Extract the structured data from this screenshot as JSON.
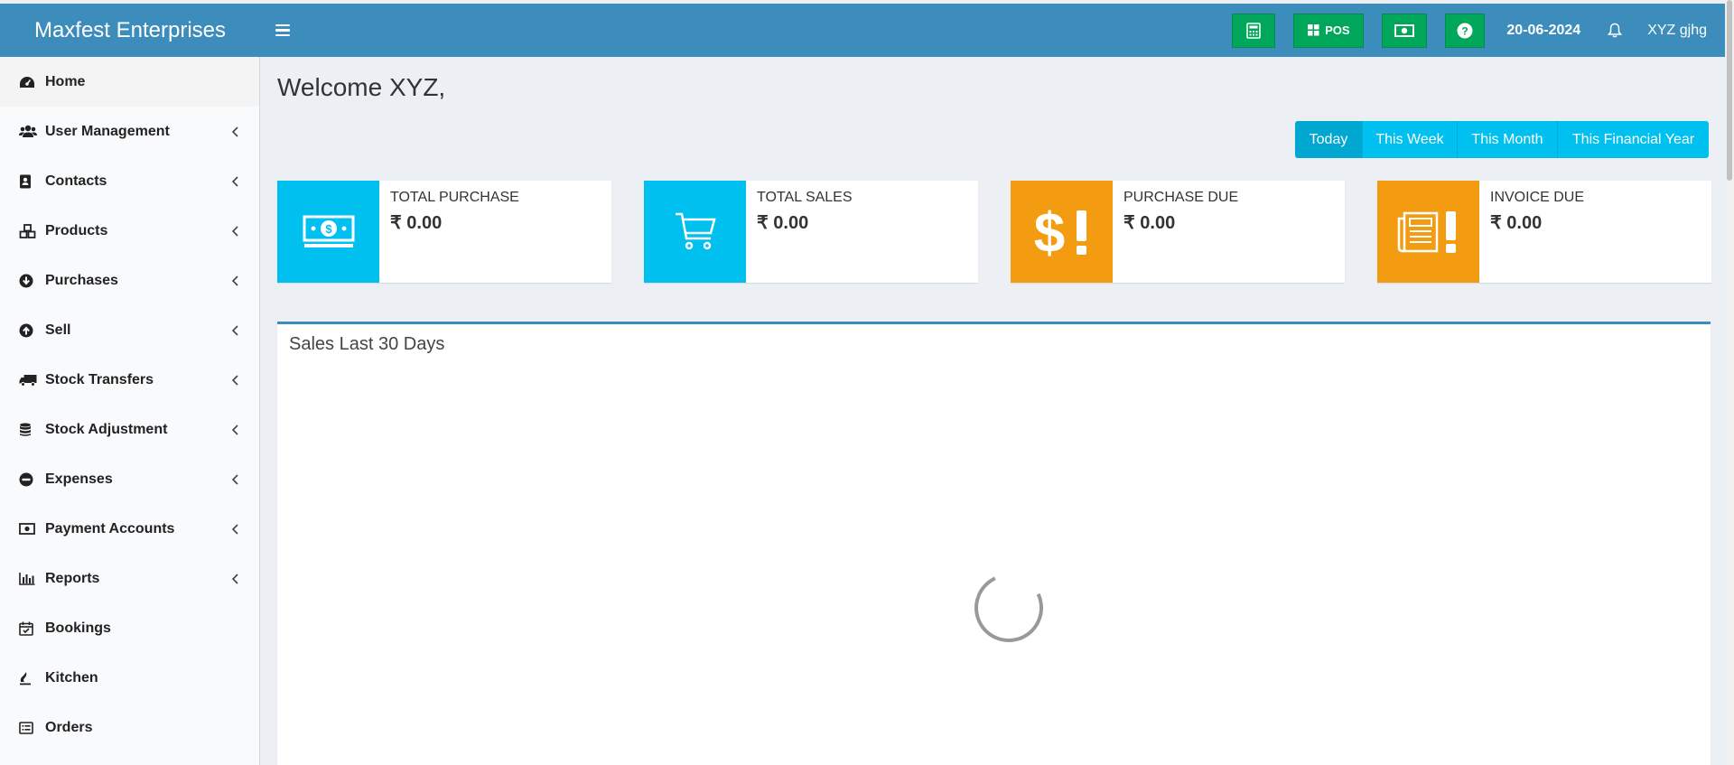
{
  "header": {
    "brand": "Maxfest Enterprises",
    "pos_label": "POS",
    "date": "20-06-2024",
    "user": "XYZ gjhg",
    "color": "#3c8dbc",
    "button_color": "#00a65a"
  },
  "sidebar": {
    "items": [
      {
        "label": "Home",
        "icon": "dashboard-icon",
        "has_submenu": false
      },
      {
        "label": "User Management",
        "icon": "users-icon",
        "has_submenu": true
      },
      {
        "label": "Contacts",
        "icon": "address-book-icon",
        "has_submenu": true
      },
      {
        "label": "Products",
        "icon": "cubes-icon",
        "has_submenu": true
      },
      {
        "label": "Purchases",
        "icon": "arrow-circle-down-icon",
        "has_submenu": true
      },
      {
        "label": "Sell",
        "icon": "arrow-circle-up-icon",
        "has_submenu": true
      },
      {
        "label": "Stock Transfers",
        "icon": "truck-icon",
        "has_submenu": true
      },
      {
        "label": "Stock Adjustment",
        "icon": "database-icon",
        "has_submenu": true
      },
      {
        "label": "Expenses",
        "icon": "minus-circle-icon",
        "has_submenu": true
      },
      {
        "label": "Payment Accounts",
        "icon": "money-bill-icon",
        "has_submenu": true
      },
      {
        "label": "Reports",
        "icon": "bar-chart-icon",
        "has_submenu": true
      },
      {
        "label": "Bookings",
        "icon": "calendar-check-icon",
        "has_submenu": false
      },
      {
        "label": "Kitchen",
        "icon": "fire-icon",
        "has_submenu": false
      },
      {
        "label": "Orders",
        "icon": "list-alt-icon",
        "has_submenu": false
      }
    ]
  },
  "main": {
    "welcome": "Welcome XYZ,",
    "ranges": [
      "Today",
      "This Week",
      "This Month",
      "This Financial Year"
    ],
    "active_range": "Today",
    "cards": [
      {
        "label": "TOTAL PURCHASE",
        "value": "₹ 0.00",
        "color": "#00c0ef",
        "icon": "money-icon"
      },
      {
        "label": "TOTAL SALES",
        "value": "₹ 0.00",
        "color": "#00c0ef",
        "icon": "shopping-cart-icon"
      },
      {
        "label": "PURCHASE DUE",
        "value": "₹ 0.00",
        "color": "#f39c12",
        "icon": "dollar-exclamation-icon"
      },
      {
        "label": "INVOICE DUE",
        "value": "₹ 0.00",
        "color": "#f39c12",
        "icon": "invoice-exclamation-icon"
      }
    ],
    "sales_box_title": "Sales Last 30 Days"
  }
}
